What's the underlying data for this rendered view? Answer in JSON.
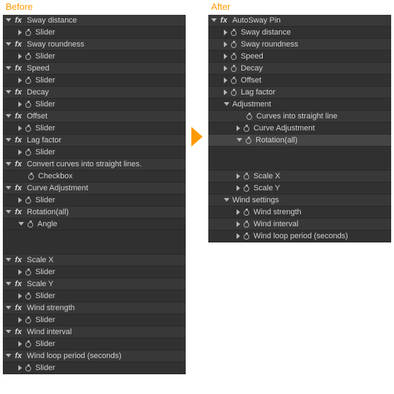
{
  "labels": {
    "before": "Before",
    "after": "After"
  },
  "fx_badge": "fx",
  "before": {
    "effects": [
      {
        "name": "Sway distance",
        "param": "Slider",
        "param_tri": "closed"
      },
      {
        "name": "Sway roundness",
        "param": "Slider",
        "param_tri": "closed"
      },
      {
        "name": "Speed",
        "param": "Slider",
        "param_tri": "closed"
      },
      {
        "name": "Decay",
        "param": "Slider",
        "param_tri": "closed"
      },
      {
        "name": "Offset",
        "param": "Slider",
        "param_tri": "closed"
      },
      {
        "name": "Lag factor",
        "param": "Slider",
        "param_tri": "closed"
      },
      {
        "name": "Convert curves into straight lines.",
        "param": "Checkbox",
        "param_tri": "none"
      },
      {
        "name": "Curve Adjustment",
        "param": "Slider",
        "param_tri": "closed"
      },
      {
        "name": "Rotation(all)",
        "param": "Angle",
        "param_tri": "open",
        "spacer_after": true
      },
      {
        "name": "Scale X",
        "param": "Slider",
        "param_tri": "closed"
      },
      {
        "name": "Scale Y",
        "param": "Slider",
        "param_tri": "closed"
      },
      {
        "name": "Wind strength",
        "param": "Slider",
        "param_tri": "closed"
      },
      {
        "name": "Wind interval",
        "param": "Slider",
        "param_tri": "closed"
      },
      {
        "name": "Wind loop period (seconds)",
        "param": "Slider",
        "param_tri": "closed"
      }
    ]
  },
  "after": {
    "effect_name": "AutoSway Pin",
    "top_params": [
      "Sway distance",
      "Sway roundness",
      "Speed",
      "Decay",
      "Offset",
      "Lag factor"
    ],
    "groups": [
      {
        "name": "Adjustment",
        "open": true,
        "children": [
          {
            "label": "Curves into straight line",
            "tri": "none"
          },
          {
            "label": "Curve Adjustment",
            "tri": "closed"
          },
          {
            "label": "Rotation(all)",
            "tri": "open",
            "spacer_after": true
          }
        ],
        "tail": [
          "Scale X",
          "Scale Y"
        ]
      },
      {
        "name": "Wind settings",
        "open": true,
        "children": [
          {
            "label": "Wind strength",
            "tri": "closed"
          },
          {
            "label": "Wind interval",
            "tri": "closed"
          },
          {
            "label": "Wind loop period (seconds)",
            "tri": "closed"
          }
        ]
      }
    ]
  }
}
